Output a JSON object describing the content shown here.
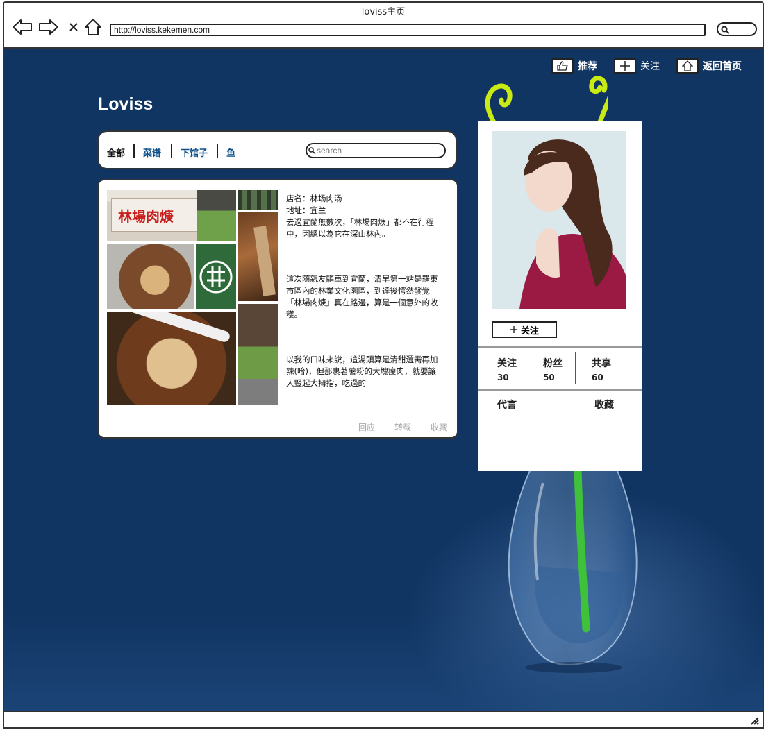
{
  "window": {
    "title": "loviss主页"
  },
  "browser": {
    "url": "http://loviss.kekemen.com"
  },
  "topnav": {
    "recommend": "推荐",
    "follow": "关注",
    "home": "返回首页"
  },
  "site": {
    "title": "Loviss"
  },
  "categories": {
    "all": "全部",
    "recipes": "菜谱",
    "restaurants": "下馆子",
    "fish": "鱼"
  },
  "search": {
    "placeholder": "search"
  },
  "post": {
    "store_line": "店名：林场肉汤",
    "address_line": "地址：宜兰",
    "para1": "去過宜蘭無數次，「林場肉焿」都不在行程中，因總以為它在深山林內。",
    "para2": "這次隨親友驅車到宜蘭，清早第一站是羅東市區內的林業文化園區，到達後愕然發覺「林場肉焿」真在路邊，算是一個意外的收穫。",
    "para3": "以我的口味來說，這湯頭算是清甜還需再加辣(哈)，但那裹著薯粉的大塊瘦肉，就要讓人豎起大拇指，吃過的",
    "sign_text": "林場肉焿",
    "actions": {
      "reply": "回应",
      "repost": "转载",
      "collect": "收藏"
    }
  },
  "profile": {
    "follow_button": "关注",
    "stats": [
      {
        "label": "关注",
        "value": "30"
      },
      {
        "label": "粉丝",
        "value": "50"
      },
      {
        "label": "共享",
        "value": "60"
      }
    ],
    "tabs": {
      "motto": "代言",
      "favorites": "收藏"
    }
  },
  "colors": {
    "background": "#103563",
    "link": "#0b4f8a",
    "stem": "#3fc23a",
    "tendril": "#c9ea12"
  }
}
